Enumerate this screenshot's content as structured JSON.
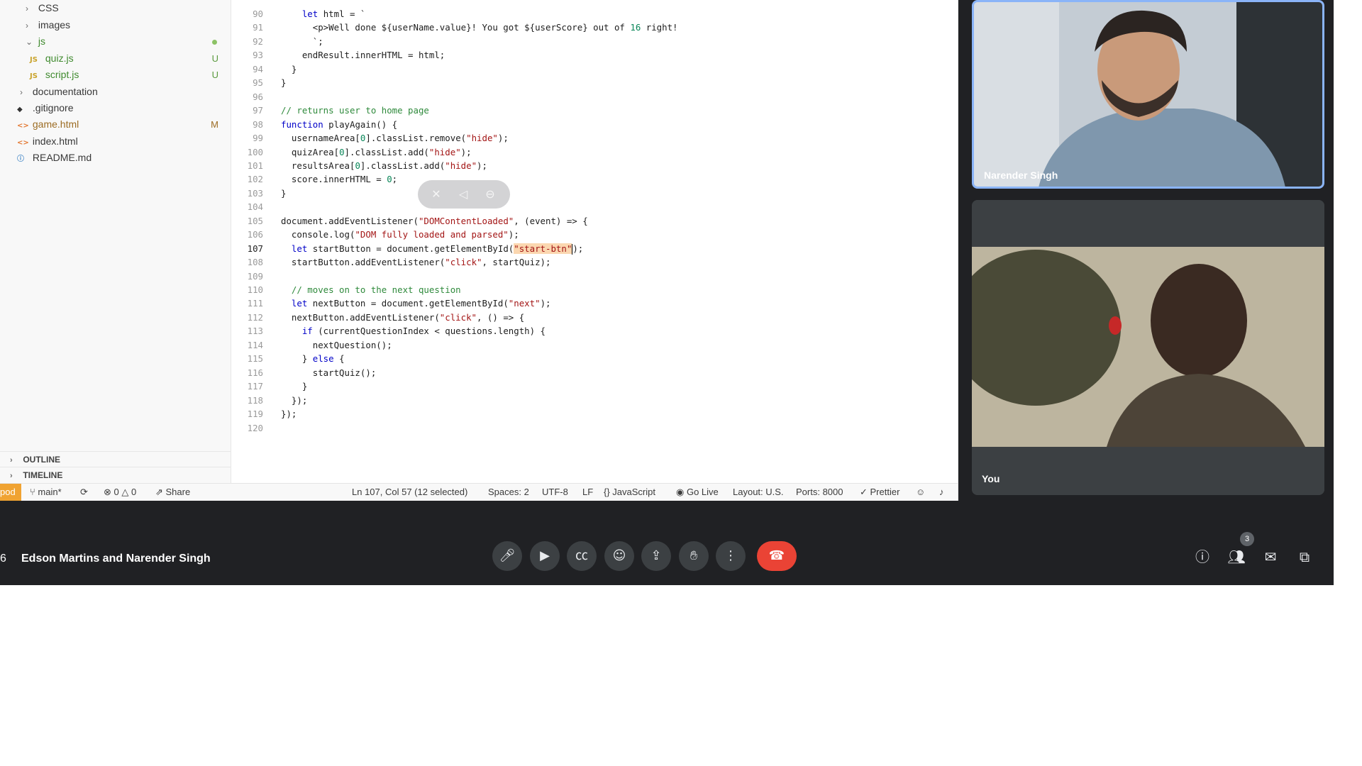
{
  "explorer": {
    "items": [
      {
        "label": "CSS",
        "type": "folder",
        "expanded": false
      },
      {
        "label": "images",
        "type": "folder",
        "expanded": false
      },
      {
        "label": "js",
        "type": "folder",
        "expanded": true
      },
      {
        "label": "quiz.js",
        "type": "js-file",
        "status": "U"
      },
      {
        "label": "script.js",
        "type": "js-file",
        "status": "U"
      },
      {
        "label": "documentation",
        "type": "folder",
        "expanded": false
      },
      {
        "label": ".gitignore",
        "type": "git-file"
      },
      {
        "label": "game.html",
        "type": "html-file",
        "status": "M"
      },
      {
        "label": "index.html",
        "type": "html-file"
      },
      {
        "label": "README.md",
        "type": "info-file"
      }
    ],
    "outline_label": "OUTLINE",
    "timeline_label": "TIMELINE"
  },
  "editor": {
    "lines": [
      {
        "n": "90",
        "text": "    let html = `"
      },
      {
        "n": "91",
        "text": "      <p>Well done ${userName.value}! You got ${userScore} out of 16 right!"
      },
      {
        "n": "92",
        "text": "      `;"
      },
      {
        "n": "93",
        "text": "    endResult.innerHTML = html;"
      },
      {
        "n": "94",
        "text": "  }"
      },
      {
        "n": "95",
        "text": "}"
      },
      {
        "n": "96",
        "text": ""
      },
      {
        "n": "97",
        "text": "// returns user to home page"
      },
      {
        "n": "98",
        "text": "function playAgain() {"
      },
      {
        "n": "99",
        "text": "  usernameArea[0].classList.remove(\"hide\");"
      },
      {
        "n": "100",
        "text": "  quizArea[0].classList.add(\"hide\");"
      },
      {
        "n": "101",
        "text": "  resultsArea[0].classList.add(\"hide\");"
      },
      {
        "n": "102",
        "text": "  score.innerHTML = 0;"
      },
      {
        "n": "103",
        "text": "}"
      },
      {
        "n": "104",
        "text": ""
      },
      {
        "n": "105",
        "text": "document.addEventListener(\"DOMContentLoaded\", (event) => {"
      },
      {
        "n": "106",
        "text": "  console.log(\"DOM fully loaded and parsed\");"
      },
      {
        "n": "107",
        "text": "  let startButton = document.getElementById(\"start-btn\");"
      },
      {
        "n": "108",
        "text": "  startButton.addEventListener(\"click\", startQuiz);"
      },
      {
        "n": "109",
        "text": ""
      },
      {
        "n": "110",
        "text": "  // moves on to the next question"
      },
      {
        "n": "111",
        "text": "  let nextButton = document.getElementById(\"next\");"
      },
      {
        "n": "112",
        "text": "  nextButton.addEventListener(\"click\", () => {"
      },
      {
        "n": "113",
        "text": "    if (currentQuestionIndex < questions.length) {"
      },
      {
        "n": "114",
        "text": "      nextQuestion();"
      },
      {
        "n": "115",
        "text": "    } else {"
      },
      {
        "n": "116",
        "text": "      startQuiz();"
      },
      {
        "n": "117",
        "text": "    }"
      },
      {
        "n": "118",
        "text": "  });"
      },
      {
        "n": "119",
        "text": "});"
      },
      {
        "n": "120",
        "text": ""
      }
    ],
    "active_line": "107",
    "selected_text": "\"start-btn\""
  },
  "statusbar": {
    "remote": "pod",
    "branch": "main*",
    "errors": "0",
    "warnings": "0",
    "share": "Share",
    "cursor": "Ln 107, Col 57 (12 selected)",
    "spaces": "Spaces: 2",
    "encoding": "UTF-8",
    "eol": "LF",
    "language": "JavaScript",
    "golive": "Go Live",
    "layout": "Layout: U.S.",
    "ports": "Ports: 8000",
    "prettier": "Prettier"
  },
  "meet": {
    "participants": [
      {
        "name": "Narender Singh",
        "speaking": true
      },
      {
        "name": "You",
        "speaking": false
      }
    ],
    "meeting_title": "Edson Martins and Narender Singh",
    "title_edge": "6",
    "people_count": "3",
    "colors": {
      "hangup": "#ea4335",
      "speaking_border": "#8ab4f8",
      "bar_bg": "#202124"
    }
  }
}
